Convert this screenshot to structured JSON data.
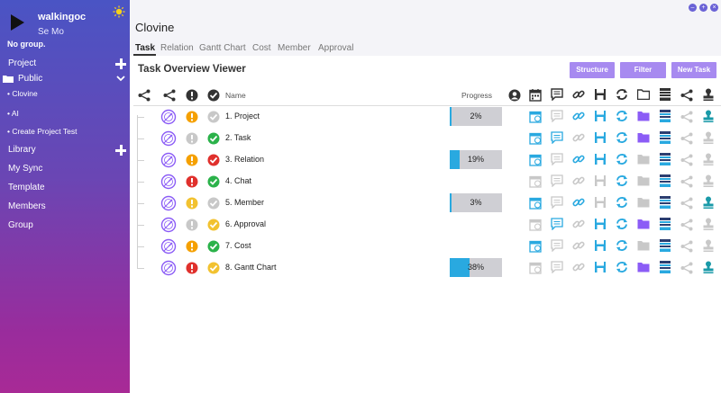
{
  "sidebar": {
    "user_name": "walkingoc",
    "user_sub": "Se Mo",
    "group_text": "No group.",
    "project_label": "Project",
    "public_label": "Public",
    "sub_items": [
      "• Clovine",
      "• AI",
      "• Create Project Test"
    ],
    "nav_items": [
      "Library",
      "My Sync",
      "Template",
      "Members",
      "Group"
    ]
  },
  "header": {
    "title": "Clovine",
    "tabs": [
      "Task",
      "Relation",
      "Gantt Chart",
      "Cost",
      "Member",
      "Approval"
    ],
    "active_tab": "Task"
  },
  "viewer": {
    "title": "Task Overview Viewer",
    "buttons": [
      "Structure",
      "Filter",
      "New Task"
    ],
    "col_name": "Name",
    "col_progress": "Progress"
  },
  "tasks": [
    {
      "name": "1. Project",
      "priority": "orange",
      "status": "gray",
      "progress": 2,
      "progress_text": "2%",
      "has_bar": true
    },
    {
      "name": "2. Task",
      "priority": "gray",
      "status": "green",
      "progress": 0,
      "progress_text": "",
      "has_bar": false
    },
    {
      "name": "3. Relation",
      "priority": "orange",
      "status": "red",
      "progress": 19,
      "progress_text": "19%",
      "has_bar": true
    },
    {
      "name": "4. Chat",
      "priority": "red",
      "status": "green",
      "progress": 0,
      "progress_text": "",
      "has_bar": false
    },
    {
      "name": "5. Member",
      "priority": "yellow",
      "status": "gray",
      "progress": 3,
      "progress_text": "3%",
      "has_bar": true
    },
    {
      "name": "6. Approval",
      "priority": "gray",
      "status": "yellow",
      "progress": 0,
      "progress_text": "",
      "has_bar": false
    },
    {
      "name": "7. Cost",
      "priority": "orange",
      "status": "green",
      "progress": 0,
      "progress_text": "",
      "has_bar": false
    },
    {
      "name": "8. Gantt Chart",
      "priority": "red",
      "status": "yellow",
      "progress": 38,
      "progress_text": "38%",
      "has_bar": true
    }
  ],
  "colors": {
    "accent": "#a78af0",
    "blue": "#29a9e0",
    "orange": "#f5a000",
    "red": "#e0302c",
    "green": "#2bb24a",
    "yellow": "#f2c230",
    "gray": "#c8c8c8",
    "purple": "#8b5cf6"
  }
}
